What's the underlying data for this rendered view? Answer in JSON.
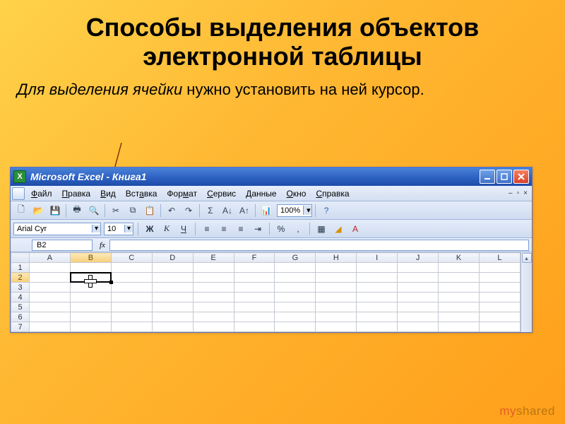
{
  "slide": {
    "title": "Способы выделения объектов электронной таблицы",
    "body_prefix_italic": "Для выделения ячейки",
    "body_rest": " нужно установить на ней курсор."
  },
  "excel": {
    "app_title": "Microsoft Excel - Книга1",
    "menu": [
      "Файл",
      "Правка",
      "Вид",
      "Вставка",
      "Формат",
      "Сервис",
      "Данные",
      "Окно",
      "Справка"
    ],
    "zoom": "100%",
    "font_name": "Arial Cyr",
    "font_size": "10",
    "format_buttons": {
      "bold": "Ж",
      "italic": "К",
      "underline": "Ч",
      "percent": "%"
    },
    "name_box": "B2",
    "columns": [
      "A",
      "B",
      "C",
      "D",
      "E",
      "F",
      "G",
      "H",
      "I",
      "J",
      "K",
      "L"
    ],
    "rows": [
      "1",
      "2",
      "3",
      "4",
      "5",
      "6",
      "7"
    ],
    "active_cell": {
      "col": "B",
      "row": "2"
    }
  },
  "watermark": {
    "prefix": "my",
    "rest": "shared"
  }
}
